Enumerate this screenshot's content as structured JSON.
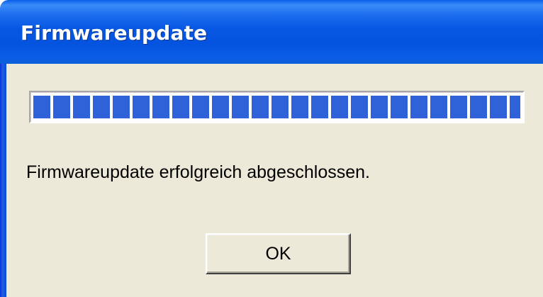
{
  "window": {
    "title": "Firmwareupdate"
  },
  "progress": {
    "value": 1.0,
    "fill_color": "#2f62d8"
  },
  "message": "Firmwareupdate erfolgreich abgeschlossen.",
  "buttons": {
    "ok_label": "OK"
  },
  "colors": {
    "titlebar": "#0757e3",
    "client_background": "#ece9d8"
  }
}
